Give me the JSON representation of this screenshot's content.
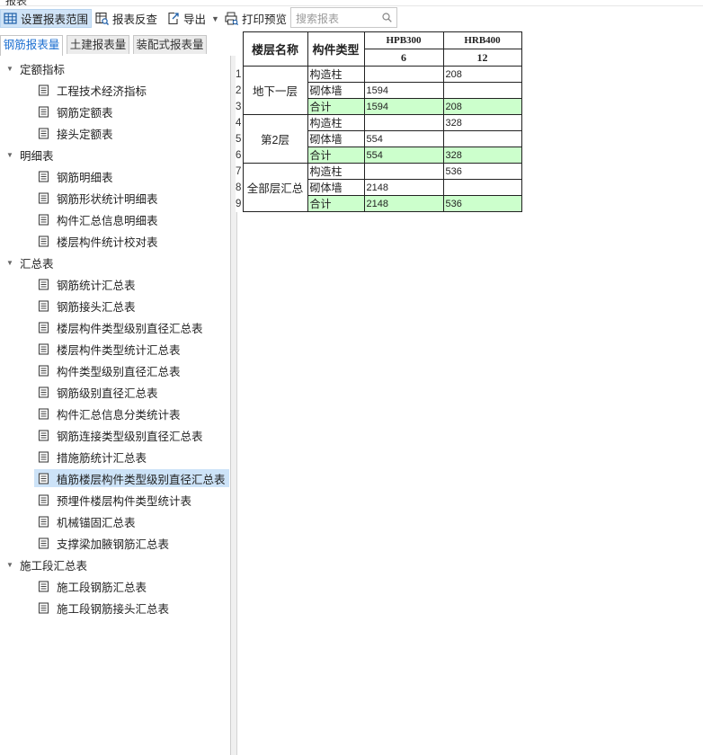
{
  "window": {
    "title": "报表"
  },
  "toolbar": {
    "set_range": "设置报表范围",
    "reverse_check": "报表反查",
    "export": "导出",
    "print_preview": "打印预览",
    "search_placeholder": "搜索报表"
  },
  "tabs": [
    {
      "label": "钢筋报表量",
      "active": true
    },
    {
      "label": "土建报表量",
      "active": false
    },
    {
      "label": "装配式报表量",
      "active": false
    }
  ],
  "tree": {
    "groups": [
      {
        "label": "定额指标",
        "items": [
          "工程技术经济指标",
          "钢筋定额表",
          "接头定额表"
        ]
      },
      {
        "label": "明细表",
        "items": [
          "钢筋明细表",
          "钢筋形状统计明细表",
          "构件汇总信息明细表",
          "楼层构件统计校对表"
        ]
      },
      {
        "label": "汇总表",
        "items": [
          "钢筋统计汇总表",
          "钢筋接头汇总表",
          "楼层构件类型级别直径汇总表",
          "楼层构件类型统计汇总表",
          "构件类型级别直径汇总表",
          "钢筋级别直径汇总表",
          "构件汇总信息分类统计表",
          "钢筋连接类型级别直径汇总表",
          "措施筋统计汇总表",
          "植筋楼层构件类型级别直径汇总表",
          "预埋件楼层构件类型统计表",
          "机械锚固汇总表",
          "支撑梁加腋钢筋汇总表"
        ]
      },
      {
        "label": "施工段汇总表",
        "items": [
          "施工段钢筋汇总表",
          "施工段钢筋接头汇总表"
        ]
      }
    ],
    "selected_item": "植筋楼层构件类型级别直径汇总表"
  },
  "report": {
    "headers": {
      "floor": "楼层名称",
      "component": "构件类型",
      "grade1": "HPB300",
      "grade1_dia": "6",
      "grade2": "HRB400",
      "grade2_dia": "12"
    },
    "row_numbers": [
      "1",
      "2",
      "3",
      "4",
      "5",
      "6",
      "7",
      "8",
      "9"
    ],
    "groups": [
      {
        "floor": "地下一层",
        "rows": [
          {
            "type": "构造柱",
            "v1": "",
            "v2": "208"
          },
          {
            "type": "砌体墙",
            "v1": "1594",
            "v2": ""
          },
          {
            "type": "合计",
            "v1": "1594",
            "v2": "208"
          }
        ]
      },
      {
        "floor": "第2层",
        "rows": [
          {
            "type": "构造柱",
            "v1": "",
            "v2": "328"
          },
          {
            "type": "砌体墙",
            "v1": "554",
            "v2": ""
          },
          {
            "type": "合计",
            "v1": "554",
            "v2": "328"
          }
        ]
      },
      {
        "floor": "全部层汇总",
        "rows": [
          {
            "type": "构造柱",
            "v1": "",
            "v2": "536"
          },
          {
            "type": "砌体墙",
            "v1": "2148",
            "v2": ""
          },
          {
            "type": "合计",
            "v1": "2148",
            "v2": "536"
          }
        ]
      }
    ],
    "total_row_color": "#ccffcc"
  }
}
